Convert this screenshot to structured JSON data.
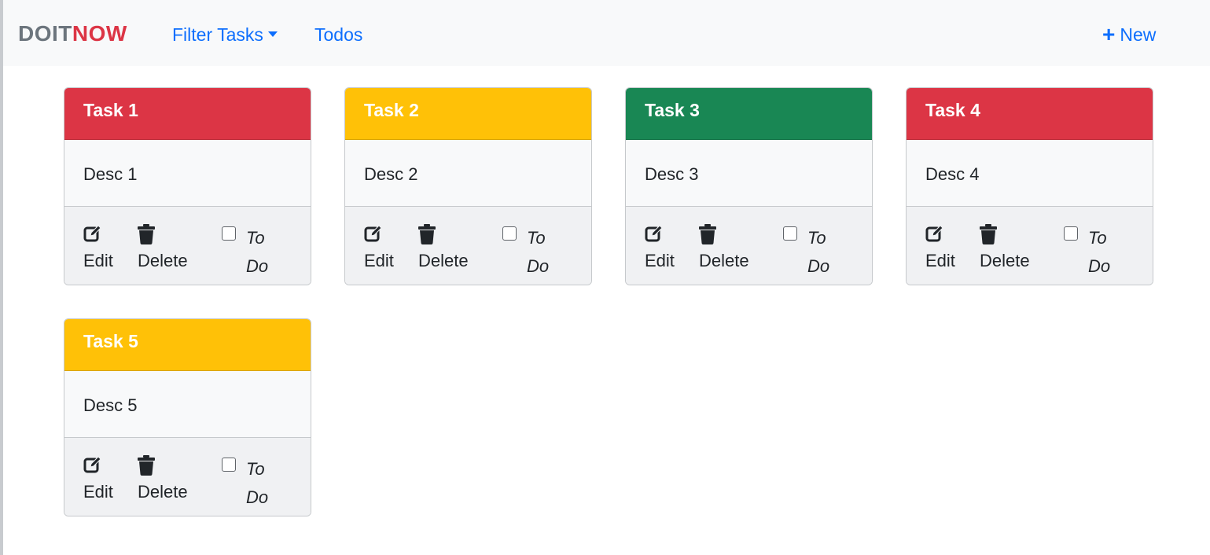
{
  "colors": {
    "danger": "#dc3545",
    "warning": "#ffc107",
    "success": "#198754",
    "link": "#0d6efd",
    "brand_gray": "#6c757d"
  },
  "navbar": {
    "brand_part1": "DOIT",
    "brand_part2": "NOW",
    "filter_label": "Filter Tasks",
    "todos_label": "Todos",
    "new_label": "New",
    "new_icon": "plus-icon"
  },
  "tasks": [
    {
      "title": "Task 1",
      "desc": "Desc 1",
      "color": "#dc3545",
      "edit_label": "Edit",
      "delete_label": "Delete",
      "todo_label": "To Do",
      "checked": false
    },
    {
      "title": "Task 2",
      "desc": "Desc 2",
      "color": "#ffc107",
      "edit_label": "Edit",
      "delete_label": "Delete",
      "todo_label": "To Do",
      "checked": false
    },
    {
      "title": "Task 3",
      "desc": "Desc 3",
      "color": "#198754",
      "edit_label": "Edit",
      "delete_label": "Delete",
      "todo_label": "To Do",
      "checked": false
    },
    {
      "title": "Task 4",
      "desc": "Desc 4",
      "color": "#dc3545",
      "edit_label": "Edit",
      "delete_label": "Delete",
      "todo_label": "To Do",
      "checked": false
    },
    {
      "title": "Task 5",
      "desc": "Desc 5",
      "color": "#ffc107",
      "edit_label": "Edit",
      "delete_label": "Delete",
      "todo_label": "To Do",
      "checked": false
    }
  ]
}
